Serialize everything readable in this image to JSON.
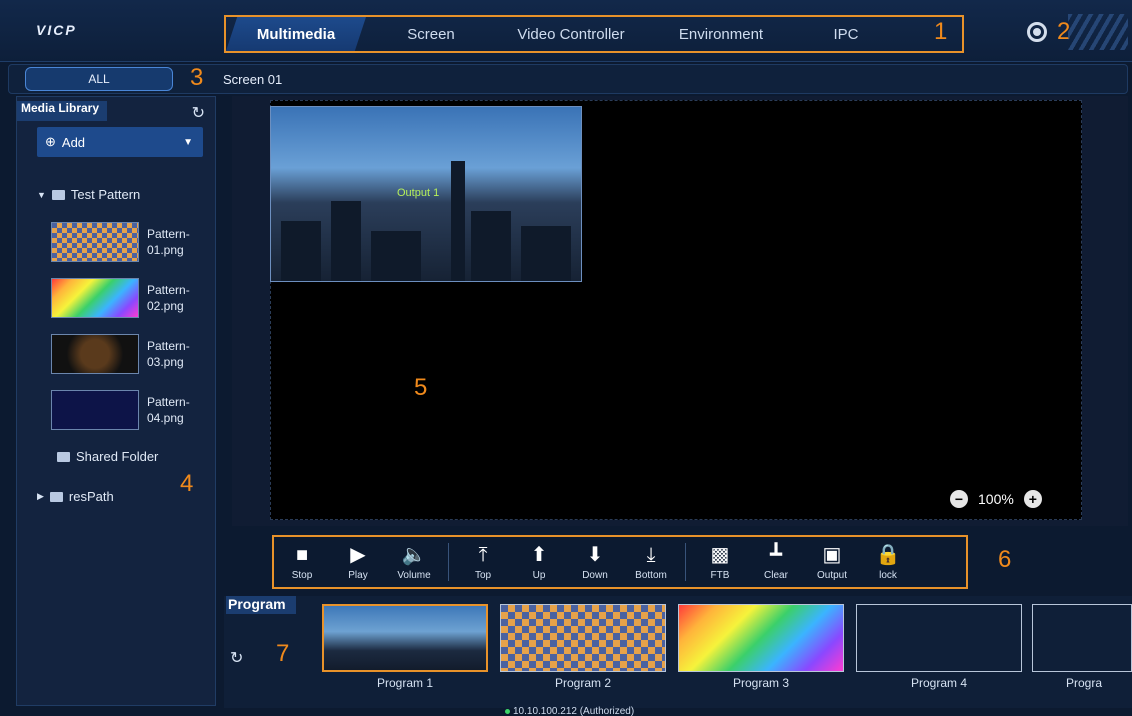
{
  "app": {
    "logo": "VICP"
  },
  "nav": {
    "tabs": [
      "Multimedia",
      "Screen",
      "Video Controller",
      "Environment",
      "IPC"
    ],
    "active": "Multimedia"
  },
  "annotations": [
    "1",
    "2",
    "3",
    "4",
    "5",
    "6",
    "7"
  ],
  "subbar": {
    "all_tab": "ALL",
    "screen": "Screen 01"
  },
  "sidebar": {
    "title": "Media Library",
    "add_label": "Add",
    "folders": [
      "Test Pattern",
      "Shared Folder",
      "resPath"
    ],
    "patterns": [
      {
        "line1": "Pattern-",
        "line2": "01.png"
      },
      {
        "line1": "Pattern-",
        "line2": "02.png"
      },
      {
        "line1": "Pattern-",
        "line2": "03.png"
      },
      {
        "line1": "Pattern-",
        "line2": "04.png"
      }
    ]
  },
  "preview": {
    "output_label": "Output 1",
    "zoom": "100%"
  },
  "toolbar": {
    "buttons": [
      "Stop",
      "Play",
      "Volume",
      "Top",
      "Up",
      "Down",
      "Bottom",
      "FTB",
      "Clear",
      "Output",
      "lock"
    ]
  },
  "program": {
    "title": "Program",
    "items": [
      "Program 1",
      "Program 2",
      "Program 3",
      "Program 4",
      "Progra"
    ],
    "active": "Program 1"
  },
  "status": "10.10.100.212 (Authorized)",
  "colors": {
    "accent": "#e8922a",
    "bg": "#0c1a30",
    "active_tab": "#1d4a8c"
  }
}
